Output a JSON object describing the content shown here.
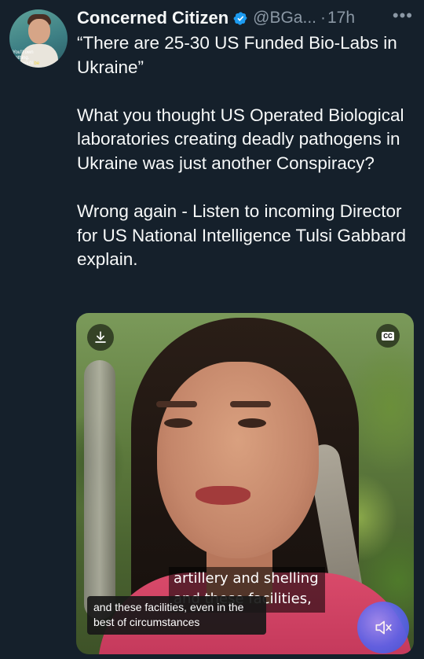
{
  "tweet": {
    "author": {
      "name": "Concerned Citizen",
      "handle": "@BGa...",
      "separator": "·",
      "time": "17h",
      "avatar_caption_line1": "You'll own nothing.",
      "avatar_caption_line2a": "And you'll ",
      "avatar_caption_line2b": "be happy."
    },
    "more_label": "•••",
    "paragraphs": [
      "“There are 25-30 US Funded Bio-Labs in Ukraine”",
      "What you thought US Operated Biological laboratories creating deadly pathogens in Ukraine was just another Conspiracy?",
      "Wrong again - Listen to incoming Director for US National Intelligence Tulsi Gabbard explain."
    ]
  },
  "media": {
    "cc_label": "CC",
    "caption_burned_line1": "artillery and shelling",
    "caption_burned_line2": "and these facilities,",
    "caption_overlay": "and these facilities, even in the best of circumstances"
  },
  "colors": {
    "background": "#15202b",
    "text": "#f7f9f9",
    "muted": "#8b98a5",
    "verified": "#1d9bf0"
  },
  "icons": [
    "verified-badge-icon",
    "more-icon",
    "download-icon",
    "closed-captions-icon",
    "mute-icon"
  ]
}
